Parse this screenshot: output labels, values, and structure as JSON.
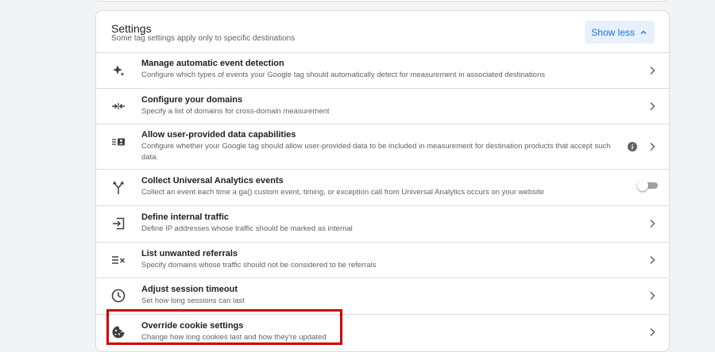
{
  "settings": {
    "title": "Settings",
    "subtitle": "Some tag settings apply only to specific destinations",
    "show_less_label": "Show less"
  },
  "rows": [
    {
      "title": "Manage automatic event detection",
      "description": "Configure which types of events your Google tag should automatically detect for measurement in associated destinations",
      "icon": "sparkle-icon",
      "control": "chevron"
    },
    {
      "title": "Configure your domains",
      "description": "Specify a list of domains for cross-domain measurement",
      "icon": "merge-arrows-icon",
      "control": "chevron"
    },
    {
      "title": "Allow user-provided data capabilities",
      "description": "Configure whether your Google tag should allow user-provided data to be included in measurement for destination products that accept such data.",
      "icon": "contact-card-icon",
      "control": "chevron",
      "has_info": true
    },
    {
      "title": "Collect Universal Analytics events",
      "description": "Collect an event each time a ga() custom event, timing, or exception call from Universal Analytics occurs on your website",
      "icon": "fork-icon",
      "control": "toggle",
      "toggle_on": false
    },
    {
      "title": "Define internal traffic",
      "description": "Define IP addresses whose traffic should be marked as internal",
      "icon": "login-icon",
      "control": "chevron"
    },
    {
      "title": "List unwanted referrals",
      "description": "Specify domains whose traffic should not be considered to be referrals",
      "icon": "list-remove-icon",
      "control": "chevron"
    },
    {
      "title": "Adjust session timeout",
      "description": "Set how long sessions can last",
      "icon": "clock-icon",
      "control": "chevron"
    },
    {
      "title": "Override cookie settings",
      "description": "Change how long cookies last and how they're updated",
      "icon": "cookie-icon",
      "control": "chevron",
      "highlighted": true
    }
  ],
  "colors": {
    "accent": "#1a73e8",
    "highlight_border": "#cc0000",
    "background": "#f1f3f4"
  }
}
